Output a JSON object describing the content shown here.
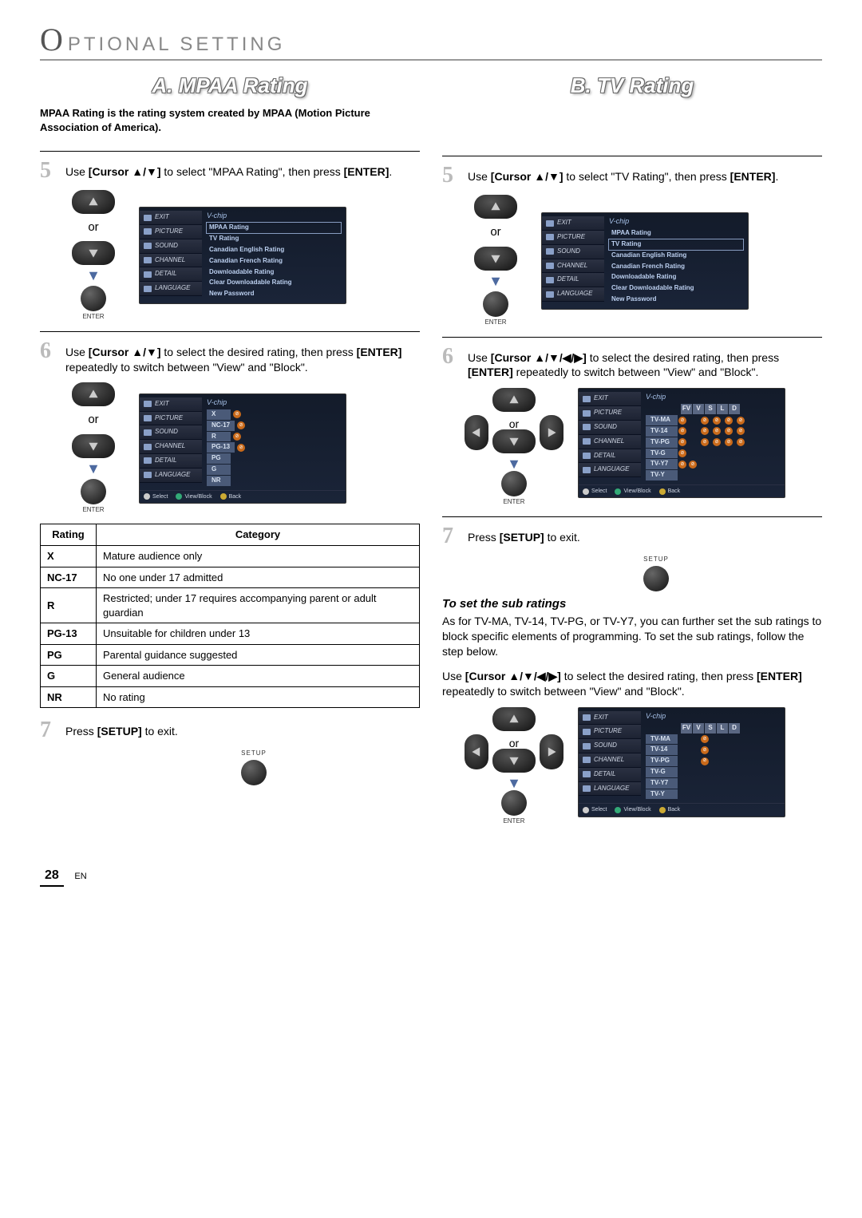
{
  "header": {
    "letter": "O",
    "text": "PTIONAL  SETTING"
  },
  "left": {
    "title": "A.  MPAA Rating",
    "intro": "MPAA Rating is the rating system created by MPAA (Motion Picture Association of America).",
    "step5_pre": "Use ",
    "step5_mid": "[Cursor ▲/▼]",
    "step5_post": " to select \"MPAA Rating\", then press ",
    "step5_end": "[ENTER]",
    "or": "or",
    "enter": "ENTER",
    "tv_menu_side": [
      "EXIT",
      "PICTURE",
      "SOUND",
      "CHANNEL",
      "DETAIL",
      "LANGUAGE"
    ],
    "tv_menu_title": "V-chip",
    "tv_menu_opts": [
      "MPAA Rating",
      "TV Rating",
      "Canadian English Rating",
      "Canadian French Rating",
      "Downloadable Rating",
      "Clear Downloadable Rating",
      "New Password"
    ],
    "step6_pre": "Use ",
    "step6_mid": "[Cursor ▲/▼]",
    "step6_post": " to select the desired rating, then press ",
    "step6_b2": "[ENTER]",
    "step6_post2": " repeatedly to switch between \"View\" and \"Block\".",
    "tv2_rows": [
      "X",
      "NC-17",
      "R",
      "PG-13",
      "PG",
      "G",
      "NR"
    ],
    "tv_foot_select": "Select",
    "tv_foot_vb": "View/Block",
    "tv_foot_back": "Back",
    "table_hdr_r": "Rating",
    "table_hdr_c": "Category",
    "table": [
      {
        "r": "X",
        "c": "Mature audience only"
      },
      {
        "r": "NC-17",
        "c": "No one under 17 admitted"
      },
      {
        "r": "R",
        "c": "Restricted; under 17 requires accompanying parent or adult guardian"
      },
      {
        "r": "PG-13",
        "c": "Unsuitable for children under 13"
      },
      {
        "r": "PG",
        "c": "Parental guidance suggested"
      },
      {
        "r": "G",
        "c": "General audience"
      },
      {
        "r": "NR",
        "c": "No rating"
      }
    ],
    "step7_pre": "Press ",
    "step7_b": "[SETUP]",
    "step7_post": " to exit.",
    "setup": "SETUP"
  },
  "right": {
    "title": "B.  TV Rating",
    "step5_pre": "Use ",
    "step5_mid": "[Cursor ▲/▼]",
    "step5_post": " to select \"TV Rating\", then press ",
    "step5_end": "[ENTER]",
    "tv_menu_sel_idx": 1,
    "step6_pre": "Use ",
    "step6_mid": "[Cursor ▲/▼/◀/▶]",
    "step6_post": " to select the desired rating, then press ",
    "step6_b2": "[ENTER]",
    "step6_post2": " repeatedly to switch between \"View\" and \"Block\".",
    "tv2_cols": [
      "FV",
      "V",
      "S",
      "L",
      "D"
    ],
    "tv2_rows": [
      "TV-MA",
      "TV-14",
      "TV-PG",
      "TV-G",
      "TV-Y7",
      "TV-Y"
    ],
    "step7_pre": "Press ",
    "step7_b": "[SETUP]",
    "step7_post": " to exit.",
    "sub_title": "To set the sub ratings",
    "sub_p1": "As for TV-MA, TV-14, TV-PG, or TV-Y7, you can further set the sub ratings to block specific elements of programming. To set the sub ratings, follow the step below.",
    "sub_p2a": "Use ",
    "sub_p2b": "[Cursor ▲/▼/◀/▶]",
    "sub_p2c": " to select the desired rating, then press ",
    "sub_p2d": "[ENTER]",
    "sub_p2e": " repeatedly to switch between \"View\" and \"Block\"."
  },
  "page": {
    "num": "28",
    "lang": "EN"
  }
}
